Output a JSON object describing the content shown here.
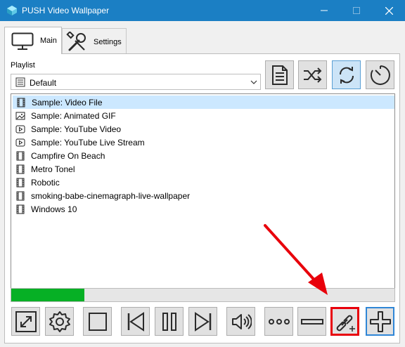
{
  "window": {
    "title": "PUSH Video Wallpaper"
  },
  "tabs": [
    {
      "label": "Main",
      "active": true,
      "icon": "monitor-icon"
    },
    {
      "label": "Settings",
      "active": false,
      "icon": "tools-icon"
    }
  ],
  "playlist": {
    "label": "Playlist",
    "selected": "Default"
  },
  "toolbar": {
    "buttons": [
      {
        "icon": "document-icon",
        "active": false
      },
      {
        "icon": "shuffle-icon",
        "active": false
      },
      {
        "icon": "repeat-icon",
        "active": true
      },
      {
        "icon": "timer-icon",
        "active": false
      }
    ]
  },
  "items": [
    {
      "label": "Sample: Video File",
      "icon": "film-icon",
      "selected": true
    },
    {
      "label": "Sample: Animated GIF",
      "icon": "image-icon",
      "selected": false
    },
    {
      "label": "Sample: YouTube Video",
      "icon": "play-icon",
      "selected": false
    },
    {
      "label": "Sample: YouTube Live Stream",
      "icon": "play-icon",
      "selected": false
    },
    {
      "label": "Campfire On Beach",
      "icon": "film-icon",
      "selected": false
    },
    {
      "label": "Metro Tonel",
      "icon": "film-icon",
      "selected": false
    },
    {
      "label": "Robotic",
      "icon": "film-icon",
      "selected": false
    },
    {
      "label": "smoking-babe-cinemagraph-live-wallpaper",
      "icon": "film-icon",
      "selected": false
    },
    {
      "label": "Windows 10",
      "icon": "film-icon",
      "selected": false
    }
  ],
  "progress": {
    "value": 0.19,
    "color": "#06b025"
  },
  "controls": [
    "fullscreen-icon",
    "settings-icon",
    "stop-icon",
    "previous-icon",
    "pause-icon",
    "next-icon",
    "volume-icon",
    "more-icon",
    "remove-icon",
    "add-url-icon",
    "add-icon"
  ],
  "colors": {
    "titlebar": "#1b7fc4",
    "selection": "#cce8ff",
    "highlight": "#e8000b",
    "accent": "#2f86d6"
  }
}
